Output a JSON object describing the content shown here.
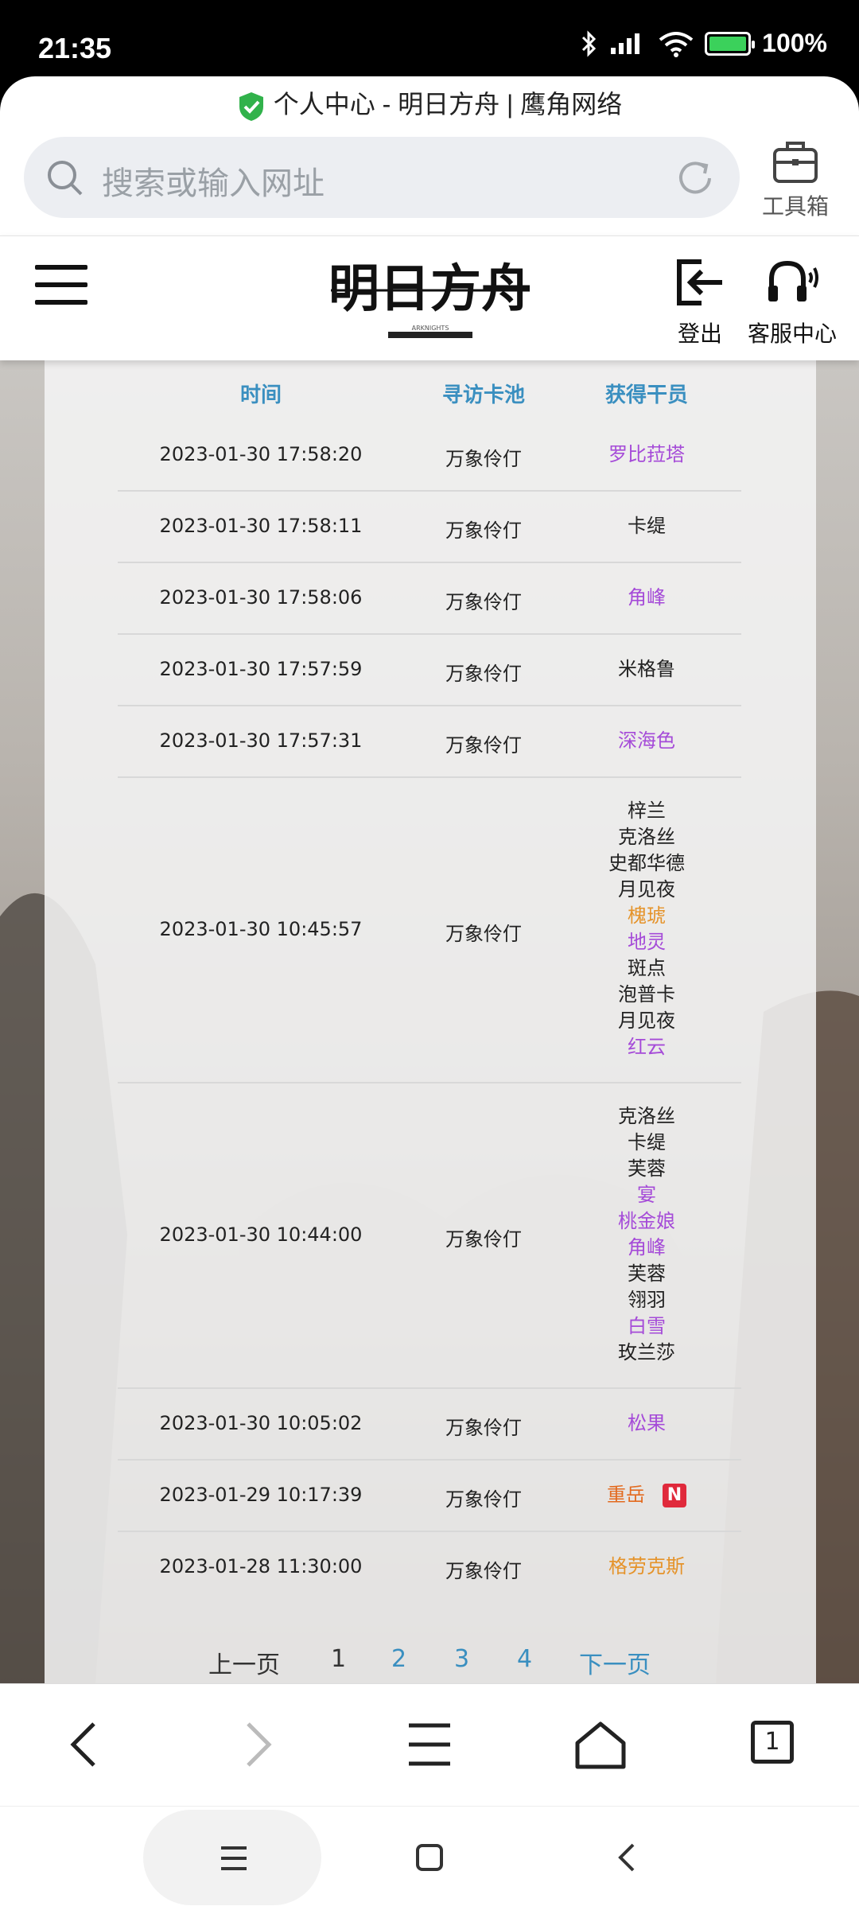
{
  "status": {
    "time": "21:35",
    "battery": "100%"
  },
  "browser": {
    "page_title": "个人中心 - 明日方舟 | 鹰角网络",
    "search_placeholder": "搜索或输入网址",
    "toolbox_label": "工具箱",
    "tab_count": "1"
  },
  "site": {
    "logout_label": "登出",
    "support_label": "客服中心"
  },
  "table": {
    "headers": {
      "time": "时间",
      "pool": "寻访卡池",
      "operators": "获得干员"
    },
    "rows": [
      {
        "time": "2023-01-30 17:58:20",
        "pool": "万象伶仃",
        "ops": [
          {
            "name": "罗比菈塔",
            "rarity": "purple"
          }
        ]
      },
      {
        "time": "2023-01-30 17:58:11",
        "pool": "万象伶仃",
        "ops": [
          {
            "name": "卡缇",
            "rarity": "black"
          }
        ]
      },
      {
        "time": "2023-01-30 17:58:06",
        "pool": "万象伶仃",
        "ops": [
          {
            "name": "角峰",
            "rarity": "purple"
          }
        ]
      },
      {
        "time": "2023-01-30 17:57:59",
        "pool": "万象伶仃",
        "ops": [
          {
            "name": "米格鲁",
            "rarity": "black"
          }
        ]
      },
      {
        "time": "2023-01-30 17:57:31",
        "pool": "万象伶仃",
        "ops": [
          {
            "name": "深海色",
            "rarity": "purple"
          }
        ]
      },
      {
        "time": "2023-01-30 10:45:57",
        "pool": "万象伶仃",
        "ops": [
          {
            "name": "梓兰",
            "rarity": "black"
          },
          {
            "name": "克洛丝",
            "rarity": "black"
          },
          {
            "name": "史都华德",
            "rarity": "black"
          },
          {
            "name": "月见夜",
            "rarity": "black"
          },
          {
            "name": "槐琥",
            "rarity": "gold"
          },
          {
            "name": "地灵",
            "rarity": "purple"
          },
          {
            "name": "斑点",
            "rarity": "black"
          },
          {
            "name": "泡普卡",
            "rarity": "black"
          },
          {
            "name": "月见夜",
            "rarity": "black"
          },
          {
            "name": "红云",
            "rarity": "purple"
          }
        ]
      },
      {
        "time": "2023-01-30 10:44:00",
        "pool": "万象伶仃",
        "ops": [
          {
            "name": "克洛丝",
            "rarity": "black"
          },
          {
            "name": "卡缇",
            "rarity": "black"
          },
          {
            "name": "芙蓉",
            "rarity": "black"
          },
          {
            "name": "宴",
            "rarity": "purple"
          },
          {
            "name": "桃金娘",
            "rarity": "purple"
          },
          {
            "name": "角峰",
            "rarity": "purple"
          },
          {
            "name": "芙蓉",
            "rarity": "black"
          },
          {
            "name": "翎羽",
            "rarity": "black"
          },
          {
            "name": "白雪",
            "rarity": "purple"
          },
          {
            "name": "玫兰莎",
            "rarity": "black"
          }
        ]
      },
      {
        "time": "2023-01-30 10:05:02",
        "pool": "万象伶仃",
        "ops": [
          {
            "name": "松果",
            "rarity": "purple"
          }
        ]
      },
      {
        "time": "2023-01-29 10:17:39",
        "pool": "万象伶仃",
        "ops": [
          {
            "name": "重岳",
            "rarity": "orange",
            "new": "N"
          }
        ]
      },
      {
        "time": "2023-01-28 11:30:00",
        "pool": "万象伶仃",
        "ops": [
          {
            "name": "格劳克斯",
            "rarity": "gold"
          }
        ]
      }
    ]
  },
  "pager": {
    "prev": "上一页",
    "pages": [
      "1",
      "2",
      "3",
      "4"
    ],
    "current": "1",
    "next": "下一页"
  },
  "colors": {
    "accent": "#3a8fc0",
    "purple": "#a54bd8",
    "gold": "#e5932a",
    "orange": "#e36a1f"
  }
}
